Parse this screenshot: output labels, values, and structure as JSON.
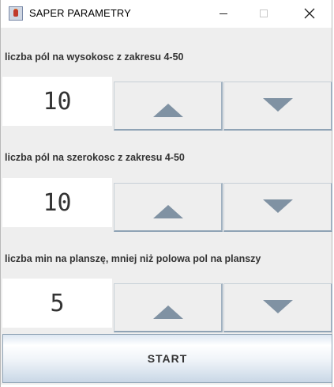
{
  "window": {
    "title": "SAPER PARAMETRY",
    "icon": "java-cup-icon",
    "controls": {
      "minimize": "minimize-icon",
      "maximize": "maximize-icon",
      "close": "close-icon"
    }
  },
  "sections": [
    {
      "label": "liczba pól na wysokosc z zakresu 4-50",
      "value": "10"
    },
    {
      "label": "liczba pól na szerokosc z zakresu 4-50",
      "value": "10"
    },
    {
      "label": "liczba min na planszę, mniej niż polowa pol na planszy",
      "value": "5"
    }
  ],
  "start_label": "START",
  "colors": {
    "arrow": "#8092a3",
    "panel": "#eeeeee"
  }
}
